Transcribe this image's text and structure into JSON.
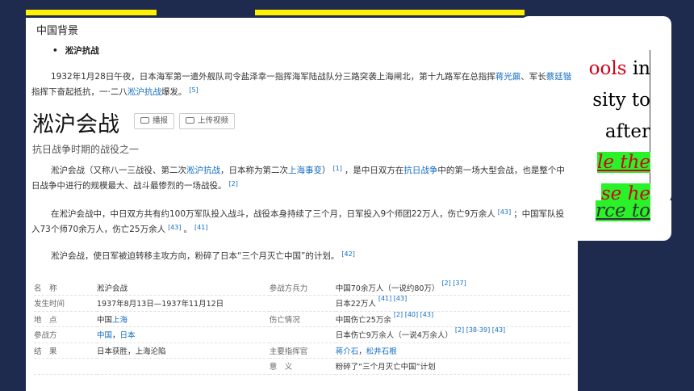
{
  "slide": {
    "lines": [
      {
        "pre": "",
        "red": "ools",
        "post": " in"
      },
      {
        "text": "sity to"
      },
      {
        "text": "after"
      },
      {
        "green": "le the"
      },
      {
        "green": "se he"
      },
      {
        "green2": "rce to"
      }
    ]
  },
  "panel": {
    "breadcrumb": "中国背景",
    "bullet": "淞沪抗战",
    "intro": {
      "t1": "1932年1月28日午夜，日本海军第一遣外舰队司令盐泽幸一指挥海军陆战队分三路突袭上海闸北，第十九路军在总指挥",
      "l1": "蒋光鼐",
      "t2": "、军长",
      "l2": "蔡廷锴",
      "t3": "指挥下奋起抵抗，一·二八",
      "l3": "淞沪抗战",
      "t4": "爆发。",
      "ref": "[5]"
    },
    "title": "淞沪会战",
    "btn_play": "播报",
    "btn_upload": "上传视频",
    "subtitle": "抗日战争时期的战役之一",
    "p1": {
      "t1": "淞沪会战（又称八一三战役、第二次",
      "l1": "淞沪抗战",
      "t2": "，日本称为第二次",
      "l2": "上海事变",
      "t3": "）",
      "r1": "[1]",
      "t4": "，是中日双方在",
      "l3": "抗日战争",
      "t5": "中的第一场大型会战，也是整个中日战争中进行的规模最大、战斗最惨烈的一场战役。",
      "r2": "[2]"
    },
    "p2": {
      "t1": "在淞沪会战中，中日双方共有约100万军队投入战斗，战役本身持续了三个月，日军投入9个师团22万人，伤亡9万余人",
      "r1": "[43]",
      "t2": "；中国军队投入73个师70余万人，伤亡25万余人",
      "r2": "[43]",
      "t3": "。",
      "r3": "[41]"
    },
    "p3": {
      "t1": "淞沪会战，使日军被迫转移主攻方向，粉碎了日本“三个月灭亡中国”的计划。",
      "r1": "[42]"
    },
    "info": {
      "r1": {
        "k1": "名　称",
        "v1": "淞沪会战",
        "k2": "参战方兵力",
        "v2": "中国70余万人（一说约80万）",
        "ref": "[2] [37]"
      },
      "r2": {
        "k1": "发生时间",
        "v1": "1937年8月13日—1937年11月12日",
        "k2": "",
        "v2": "日本22万人",
        "ref": "[41] [43]"
      },
      "r3": {
        "k1": "地　点",
        "v1a": "中国",
        "v1b": "上海",
        "k2": "伤亡情况",
        "v2": "中国伤亡25万余",
        "ref": "[2] [40] [43]"
      },
      "r4": {
        "k1": "参战方",
        "v1a": "中国",
        "sep": "，",
        "v1b": "日本",
        "k2": "",
        "v2": "日本伤亡9万余人（一说4万余人）",
        "ref": "[2] [38-39] [43]"
      },
      "r5": {
        "k1": "结　果",
        "v1": "日本获胜，上海沦陷",
        "k2": "主要指挥官",
        "v2a": "蒋介石",
        "sep": "，",
        "v2b": "松井石根"
      },
      "r6": {
        "k2": "意　义",
        "v2": "粉碎了“三个月灭亡中国”计划"
      }
    }
  }
}
